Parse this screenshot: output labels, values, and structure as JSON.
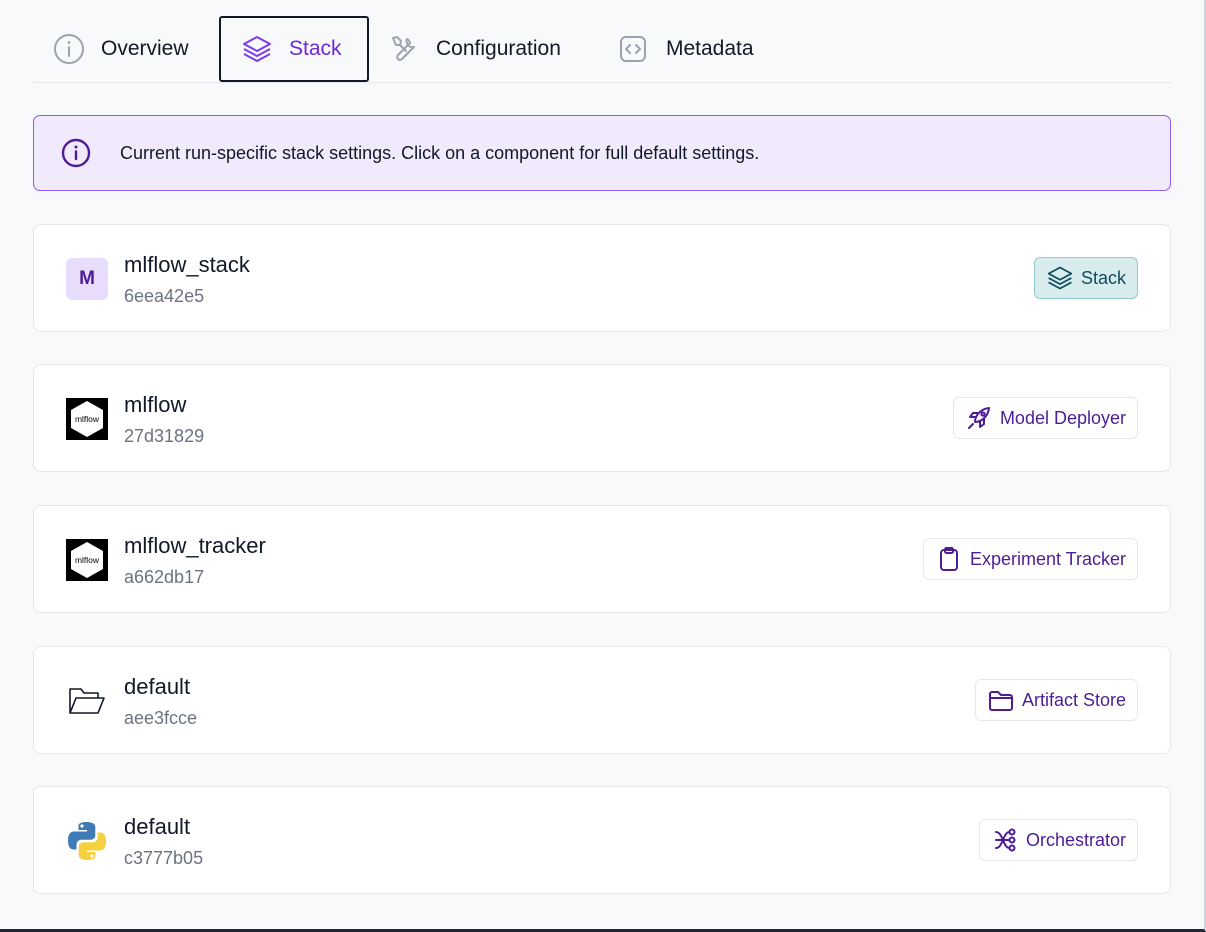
{
  "tabs": [
    {
      "label": "Overview",
      "icon": "info-icon"
    },
    {
      "label": "Stack",
      "icon": "layers-icon",
      "active": true
    },
    {
      "label": "Configuration",
      "icon": "tools-icon"
    },
    {
      "label": "Metadata",
      "icon": "code-brackets-icon"
    }
  ],
  "banner": {
    "text": "Current run-specific stack settings. Click on a component for full default settings.",
    "icon": "info-icon"
  },
  "components": [
    {
      "name": "mlflow_stack",
      "id": "6eea42e5",
      "logo": "M",
      "logo_type": "avatar-letter",
      "badge": "Stack",
      "badge_icon": "layers-icon"
    },
    {
      "name": "mlflow",
      "id": "27d31829",
      "logo_text": "mlflow",
      "logo_type": "mlflow-logo",
      "badge": "Model Deployer",
      "badge_icon": "rocket-icon"
    },
    {
      "name": "mlflow_tracker",
      "id": "a662db17",
      "logo_text": "mlflow",
      "logo_type": "mlflow-logo",
      "badge": "Experiment Tracker",
      "badge_icon": "clipboard-icon"
    },
    {
      "name": "default",
      "id": "aee3fcce",
      "logo_type": "open-folder-icon",
      "badge": "Artifact Store",
      "badge_icon": "folder-icon"
    },
    {
      "name": "default",
      "id": "c3777b05",
      "logo_type": "python-logo",
      "badge": "Orchestrator",
      "badge_icon": "workflow-icon"
    }
  ],
  "colors": {
    "accent": "#6d28d9",
    "banner_bg": "#f1eafd",
    "banner_border": "#8b5cf6",
    "badge_text": "#4c1d95",
    "stack_badge_bg": "#d8ecee"
  }
}
